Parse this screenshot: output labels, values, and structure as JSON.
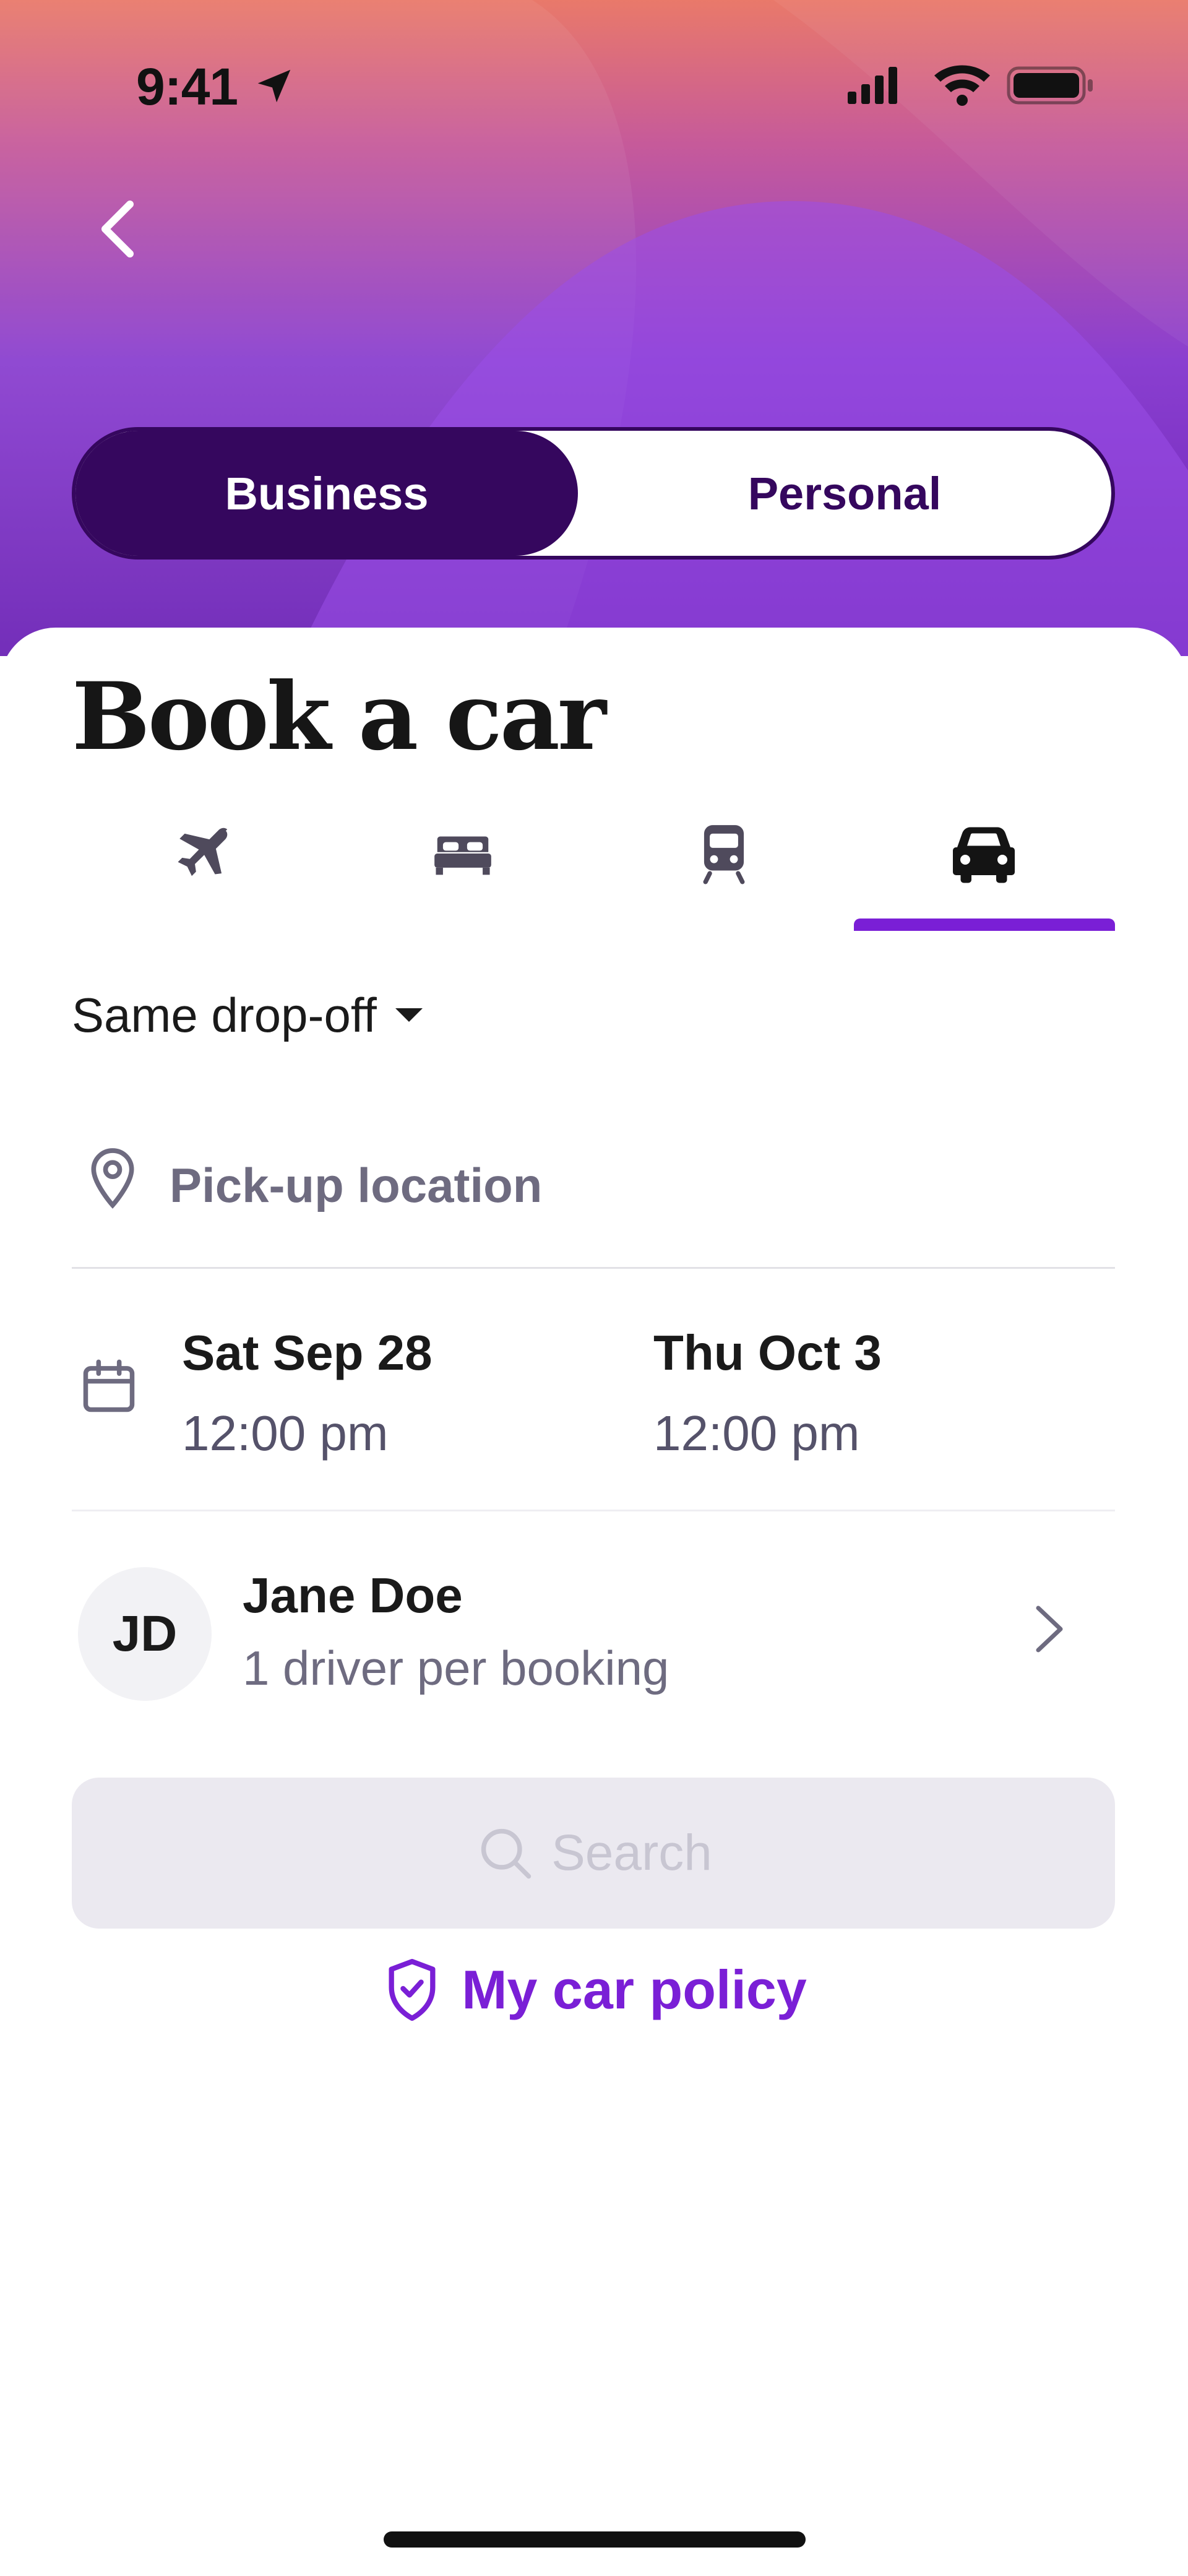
{
  "status_bar": {
    "time": "9:41",
    "icons": [
      "location-arrow-icon",
      "cellular-signal-icon",
      "wifi-icon",
      "battery-icon"
    ]
  },
  "header": {
    "back_icon": "chevron-left-icon",
    "segment": {
      "options": [
        {
          "label": "Business",
          "selected": true
        },
        {
          "label": "Personal",
          "selected": false
        }
      ]
    }
  },
  "page": {
    "title": "Book a car"
  },
  "tabs": [
    {
      "icon": "airplane-icon",
      "active": false
    },
    {
      "icon": "bed-icon",
      "active": false
    },
    {
      "icon": "train-icon",
      "active": false
    },
    {
      "icon": "car-icon",
      "active": true
    }
  ],
  "form": {
    "dropoff_mode": "Same drop-off",
    "location_placeholder": "Pick-up location",
    "pickup": {
      "date": "Sat Sep 28",
      "time": "12:00 pm"
    },
    "dropoff": {
      "date": "Thu Oct 3",
      "time": "12:00 pm"
    }
  },
  "driver": {
    "initials": "JD",
    "name": "Jane Doe",
    "subtitle": "1 driver per booking"
  },
  "actions": {
    "search_label": "Search",
    "policy_label": "My car policy"
  },
  "colors": {
    "accent": "#7a1fd6",
    "segment_dark": "#35075e",
    "muted_text": "#6e6b80",
    "disabled_bg": "#ebe9f0"
  }
}
